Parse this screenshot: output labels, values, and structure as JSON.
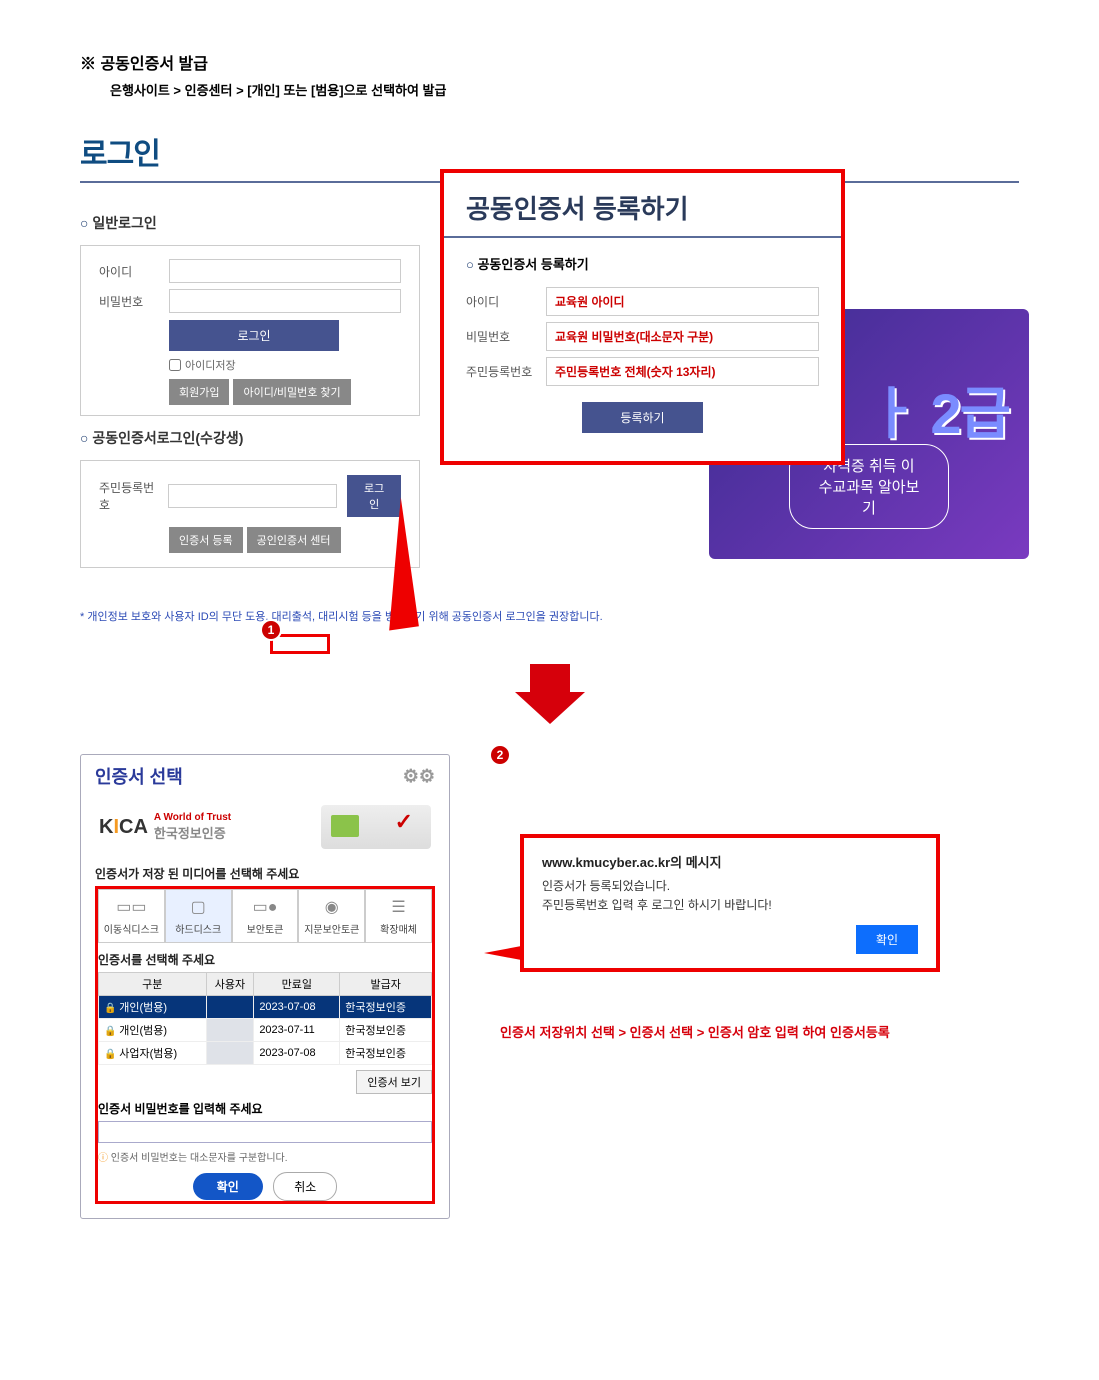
{
  "top": {
    "title": "※ 공동인증서 발급",
    "subtitle": "은행사이트 > 인증센터 > [개인] 또는 [범용]으로 선택하여 발급"
  },
  "login": {
    "title": "로그인",
    "general_label": "일반로그인",
    "id_label": "아이디",
    "pw_label": "비밀번호",
    "login_btn": "로그인",
    "save_id": "아이디저장",
    "signup": "회원가입",
    "find": "아이디/비밀번호 찾기",
    "cert_label": "공동인증서로그인(수강생)",
    "rrn_label": "주민등록번호",
    "cert_reg_btn": "인증서 등록",
    "cert_center_btn": "공인인증서 센터",
    "cert_mini_login": "로그인"
  },
  "popup": {
    "title": "공동인증서 등록하기",
    "section_label": "공동인증서 등록하기",
    "id_label": "아이디",
    "id_val": "교육원 아이디",
    "pw_label": "비밀번호",
    "pw_val": "교육원 비밀번호(대소문자 구분)",
    "rrn_label": "주민등록번호",
    "rrn_val": "주민등록번호 전체(숫자 13자리)",
    "register_btn": "등록하기"
  },
  "banner": {
    "big": "ㅏ 2급",
    "cta": "자격증 취득 이수교과목 알아보기"
  },
  "note": "* 개인정보 보호와 사용자 ID의 무단 도용, 대리출석, 대리시험 등을 방지하기 위해 공동인증서 로그인을 권장합니다.",
  "certwin": {
    "title": "인증서 선택",
    "kica_world": "A World of Trust",
    "kica_kor": "한국정보인증",
    "media_label": "인증서가 저장 된 미디어를 선택해 주세요",
    "media": [
      "이동식디스크",
      "하드디스크",
      "보안토큰",
      "지문보안토큰",
      "확장매체"
    ],
    "table_label": "인증서를 선택해 주세요",
    "columns": [
      "구분",
      "사용자",
      "만료일",
      "발급자"
    ],
    "rows": [
      {
        "type": "개인(범용)",
        "user": "",
        "expire": "2023-07-08",
        "issuer": "한국정보인증",
        "selected": true
      },
      {
        "type": "개인(범용)",
        "user": "",
        "expire": "2023-07-11",
        "issuer": "한국정보인증",
        "selected": false
      },
      {
        "type": "사업자(범용)",
        "user": "",
        "expire": "2023-07-08",
        "issuer": "한국정보인증",
        "selected": false
      }
    ],
    "view_btn": "인증서 보기",
    "pw_label": "인증서 비밀번호를 입력해 주세요",
    "pw_hint": "인증서 비밀번호는 대소문자를 구분합니다.",
    "ok": "확인",
    "cancel": "취소"
  },
  "alert": {
    "url": "www.kmucyber.ac.kr의 메시지",
    "line1": "인증서가 등록되었습니다.",
    "line2": "주민등록번호 입력 후 로그인 하시기 바랍니다!",
    "ok": "확인"
  },
  "process": "인증서 저장위치 선택 > 인증서 선택 > 인증서 암호 입력 하여 인증서등록",
  "badges": {
    "one": "1",
    "two": "2"
  }
}
